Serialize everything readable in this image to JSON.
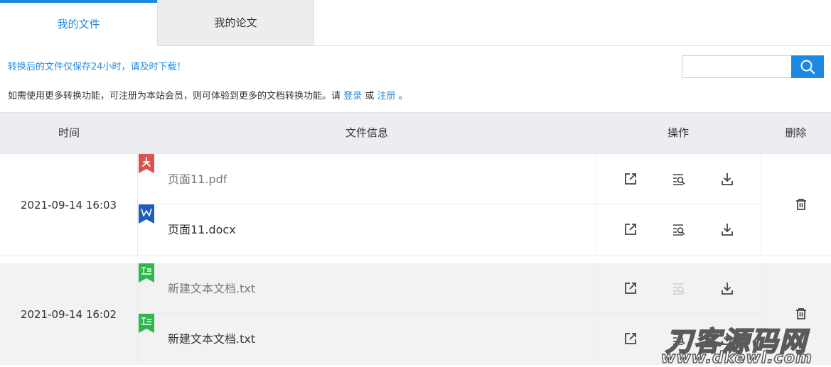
{
  "tabs": [
    {
      "label": "我的文件",
      "active": true
    },
    {
      "label": "我的论文",
      "active": false
    }
  ],
  "notice": {
    "retention": "转换后的文件仅保存24小时，请及时下载！",
    "member_text": "如需使用更多转换功能，可注册为本站会员，则可体验到更多的文档转换功能。请",
    "login_label": "登录",
    "or_text": "或",
    "register_label": "注册",
    "end_text": "。"
  },
  "search": {
    "value": "",
    "placeholder": "",
    "icon": "search-icon"
  },
  "table": {
    "headers": {
      "time": "时间",
      "file_info": "文件信息",
      "actions": "操作",
      "delete": "删除"
    },
    "groups": [
      {
        "time": "2021-09-14 16:03",
        "files": [
          {
            "name": "页面11.pdf",
            "type": "pdf",
            "icon": "pdf-icon",
            "view_enabled": true
          },
          {
            "name": "页面11.docx",
            "type": "docx",
            "icon": "word-icon",
            "view_enabled": true
          }
        ]
      },
      {
        "time": "2021-09-14 16:02",
        "files": [
          {
            "name": "新建文本文档.txt",
            "type": "txt",
            "icon": "text-file-icon",
            "view_enabled": false
          },
          {
            "name": "新建文本文档.txt",
            "type": "txt",
            "icon": "text-file-icon",
            "view_enabled": true
          }
        ]
      }
    ]
  },
  "watermark": {
    "title": "刀客源码网",
    "url": "www.dkewl.com"
  },
  "colors": {
    "accent": "#1f8ae0",
    "search_button": "#1e88e5",
    "header_bg": "#ecedf0",
    "pdf": "#d9534f",
    "word": "#1e5bbf",
    "txt": "#2db84d"
  }
}
